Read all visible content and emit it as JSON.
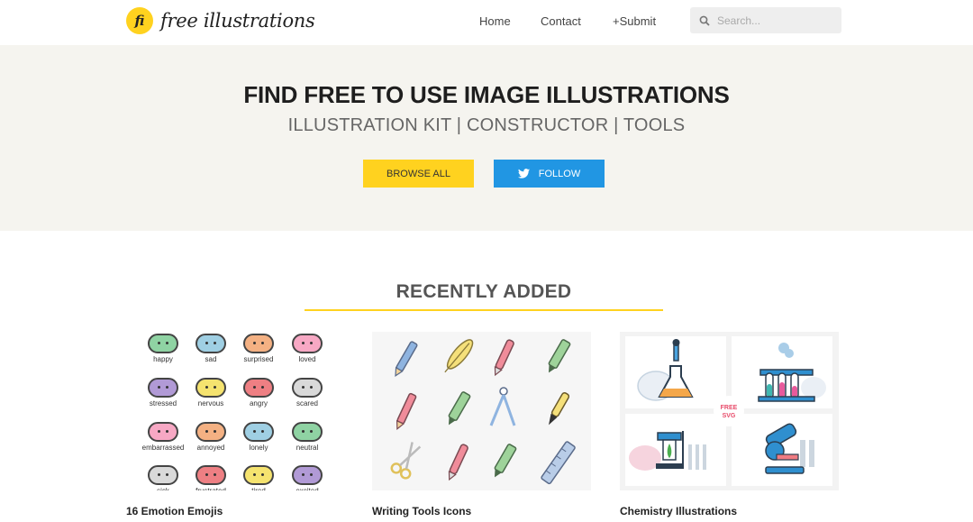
{
  "header": {
    "logo_mark": "fi",
    "logo_text": "free illustrations",
    "nav": [
      "Home",
      "Contact",
      "+Submit"
    ],
    "search_placeholder": "Search..."
  },
  "hero": {
    "title": "FIND FREE TO USE IMAGE ILLUSTRATIONS",
    "subtitle": "ILLUSTRATION KIT | CONSTRUCTOR | TOOLS",
    "browse_label": "BROWSE ALL",
    "follow_label": "FOLLOW"
  },
  "recent": {
    "heading": "RECENTLY ADDED",
    "cards": [
      {
        "title": "16 Emotion Emojis",
        "emojis": [
          {
            "label": "happy",
            "color": "#8fd3a3"
          },
          {
            "label": "sad",
            "color": "#9fcfe3"
          },
          {
            "label": "surprised",
            "color": "#f4b183"
          },
          {
            "label": "loved",
            "color": "#f7a8c4"
          },
          {
            "label": "stressed",
            "color": "#b19ad6"
          },
          {
            "label": "nervous",
            "color": "#f5e36f"
          },
          {
            "label": "angry",
            "color": "#ee7f83"
          },
          {
            "label": "scared",
            "color": "#d9d9d9"
          },
          {
            "label": "embarrassed",
            "color": "#f7a8c4"
          },
          {
            "label": "annoyed",
            "color": "#f4b183"
          },
          {
            "label": "lonely",
            "color": "#9fcfe3"
          },
          {
            "label": "neutral",
            "color": "#8fd3a3"
          },
          {
            "label": "sick",
            "color": "#d9d9d9"
          },
          {
            "label": "frustrated",
            "color": "#ee7f83"
          },
          {
            "label": "tired",
            "color": "#f5e36f"
          },
          {
            "label": "excited",
            "color": "#b19ad6"
          }
        ]
      },
      {
        "title": "Writing Tools Icons"
      },
      {
        "title": "Chemistry Illustrations",
        "badge": "FREE SVG"
      }
    ]
  },
  "colors": {
    "accent_yellow": "#ffd21f",
    "twitter_blue": "#2196e3",
    "hero_bg": "#f5f4ef"
  }
}
